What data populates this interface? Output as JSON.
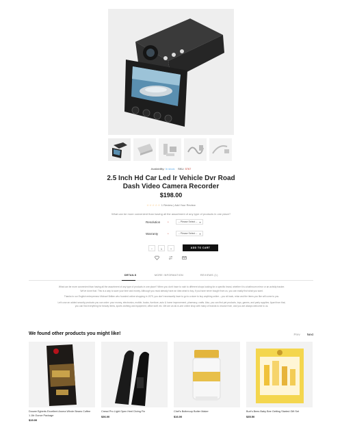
{
  "product": {
    "availability_label": "Availability:",
    "availability_value": "In stock",
    "sku_label": "SKU:",
    "sku_value": "5767",
    "title": "2.5 Inch Hd Car Led Ir Vehicle Dvr Road Dash Video Camera Recorder",
    "price": "$198.00",
    "stars": "☆☆☆☆☆",
    "reviews_count": "1 Review",
    "add_review": "Add Your Review",
    "short_description": "What can be more convenient than having all the assortment of any type of products in one place?",
    "options": [
      {
        "label": "Resolution",
        "value": "-- Please Select --"
      },
      {
        "label": "Warranty",
        "value": "-- Please Select --"
      }
    ],
    "qty_minus": "−",
    "qty_value": "1",
    "qty_plus": "+",
    "add_to_cart": "ADD TO CART"
  },
  "tabs": [
    {
      "label": "DETAILS"
    },
    {
      "label": "MORE INFORMATION"
    },
    {
      "label": "REVIEWS (1)"
    }
  ],
  "details": [
    "What can be more convenient than having all the assortment of any type of products in one place? When you don't have to rush to different shops looking for a specific brand, whether it is a bathroom mirror or an activity tracker. We've done that. This is a way to save your time and money. Although you must already have an idea what to buy, if you have never bought from us, you can easily find what you want.",
    "Thanks to our English entrepreneur Michael Britten who founded online shopping in 1979, you don't necessarily have to go to a store to buy anything online – you sit back, relax and the items you like will come to you.",
    "Let's use an added security products you can order: your money, electronics, mobile, books, furniture, auto & home improvement, pharmacy, crafts. Also, you can find pet products, toys, games, and party supplies. Apart from that, you can find everything for beauty items, sports clothing and equipment, office stuff, etc. We are an all-in-one online shop with many of brands to choose from, and you are always welcome to us."
  ],
  "recommendations": {
    "title": "We found other products you might like!",
    "prev": "Prev",
    "next": "Next",
    "items": [
      {
        "name": "Douwe Egberts Excellent Aroma Whole Beans Coffee 1.1lb Ounce Package",
        "price": "$19.00"
      },
      {
        "name": "Cressi Pro Light Open Heel Diving Fin",
        "price": "$36.00"
      },
      {
        "name": "Chef's Buttercup Butter Maker",
        "price": "$16.00"
      },
      {
        "name": "Burt's Bees Baby Bee Getting Started Gift Set",
        "price": "$35.50"
      }
    ]
  },
  "colors": {
    "accent": "#111111",
    "instock": "#5aa9e6",
    "sku": "#c0392b",
    "star": "#f0ad4e"
  }
}
